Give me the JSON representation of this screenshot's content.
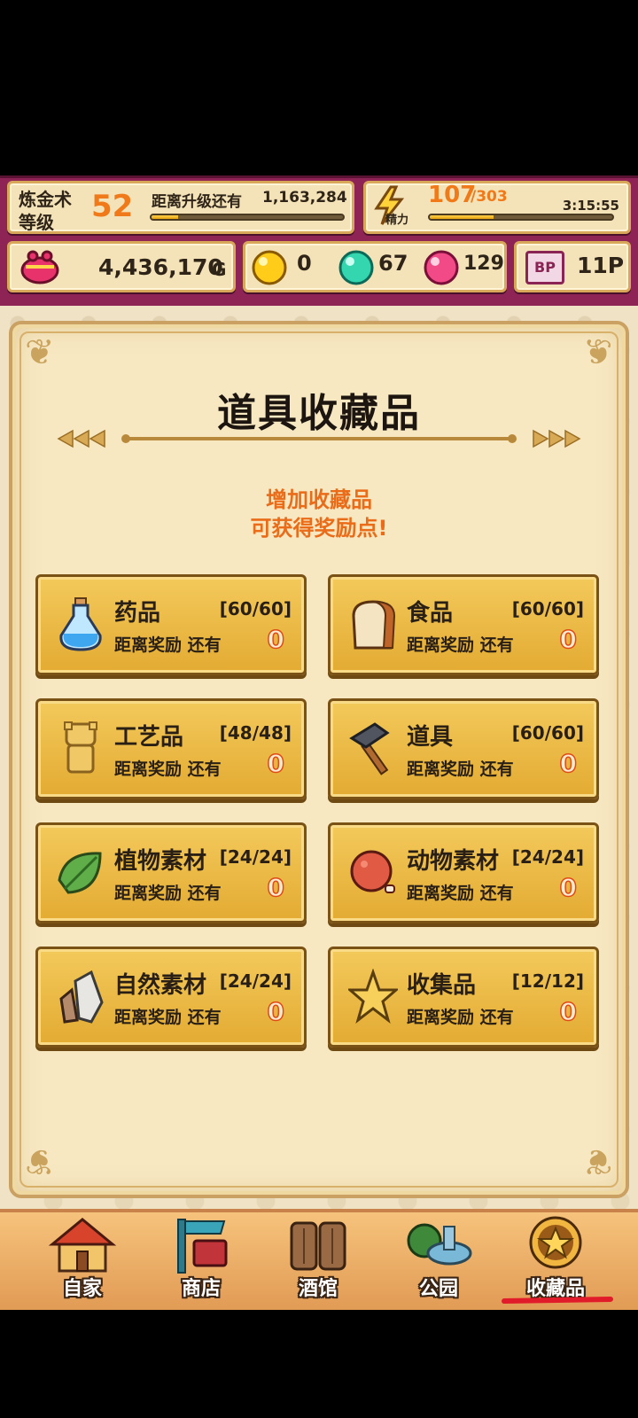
{
  "hud": {
    "alchemy_label_1": "炼金术",
    "alchemy_label_2": "等级",
    "level": "52",
    "next_level_label": "距离升级还有",
    "next_level_value": "1,163,284",
    "level_progress": 0.14,
    "stamina_label": "精力",
    "stamina_current": "107",
    "stamina_max": "/303",
    "stamina_progress": 0.35,
    "timer": "3:15:55",
    "gold": "4,436,170",
    "gold_unit": "G",
    "gem_yellow": "0",
    "gem_cyan": "67",
    "gem_pink": "129",
    "bp_label": "BP",
    "bp_value": "11P"
  },
  "page": {
    "title": "道具收藏品",
    "subtitle_line1": "增加收藏品",
    "subtitle_line2": "可获得奖励点!"
  },
  "cards": [
    {
      "name": "药品",
      "count": "[60/60]",
      "dist": "距离奖励 还有",
      "num": "0",
      "icon": "potion-icon"
    },
    {
      "name": "食品",
      "count": "[60/60]",
      "dist": "距离奖励 还有",
      "num": "0",
      "icon": "bread-icon"
    },
    {
      "name": "工艺品",
      "count": "[48/48]",
      "dist": "距离奖励 还有",
      "num": "0",
      "icon": "figurine-icon"
    },
    {
      "name": "道具",
      "count": "[60/60]",
      "dist": "距离奖励 还有",
      "num": "0",
      "icon": "hammer-icon"
    },
    {
      "name": "植物素材",
      "count": "[24/24]",
      "dist": "距离奖励 还有",
      "num": "0",
      "icon": "leaf-icon"
    },
    {
      "name": "动物素材",
      "count": "[24/24]",
      "dist": "距离奖励 还有",
      "num": "0",
      "icon": "meat-icon"
    },
    {
      "name": "自然素材",
      "count": "[24/24]",
      "dist": "距离奖励 还有",
      "num": "0",
      "icon": "stone-icon"
    },
    {
      "name": "收集品",
      "count": "[12/12]",
      "dist": "距离奖励 还有",
      "num": "0",
      "icon": "star-icon"
    }
  ],
  "nav": [
    {
      "label": "自家",
      "icon": "house-icon"
    },
    {
      "label": "商店",
      "icon": "shop-icon"
    },
    {
      "label": "酒馆",
      "icon": "tavern-icon"
    },
    {
      "label": "公园",
      "icon": "park-icon"
    },
    {
      "label": "收藏品",
      "icon": "collection-medal-icon",
      "active": true
    }
  ],
  "colors": {
    "hud_bg": "#8e2455",
    "card_gold": "#e3ab32",
    "accent_orange": "#f07a1a",
    "active_underline": "#e11b2a"
  }
}
